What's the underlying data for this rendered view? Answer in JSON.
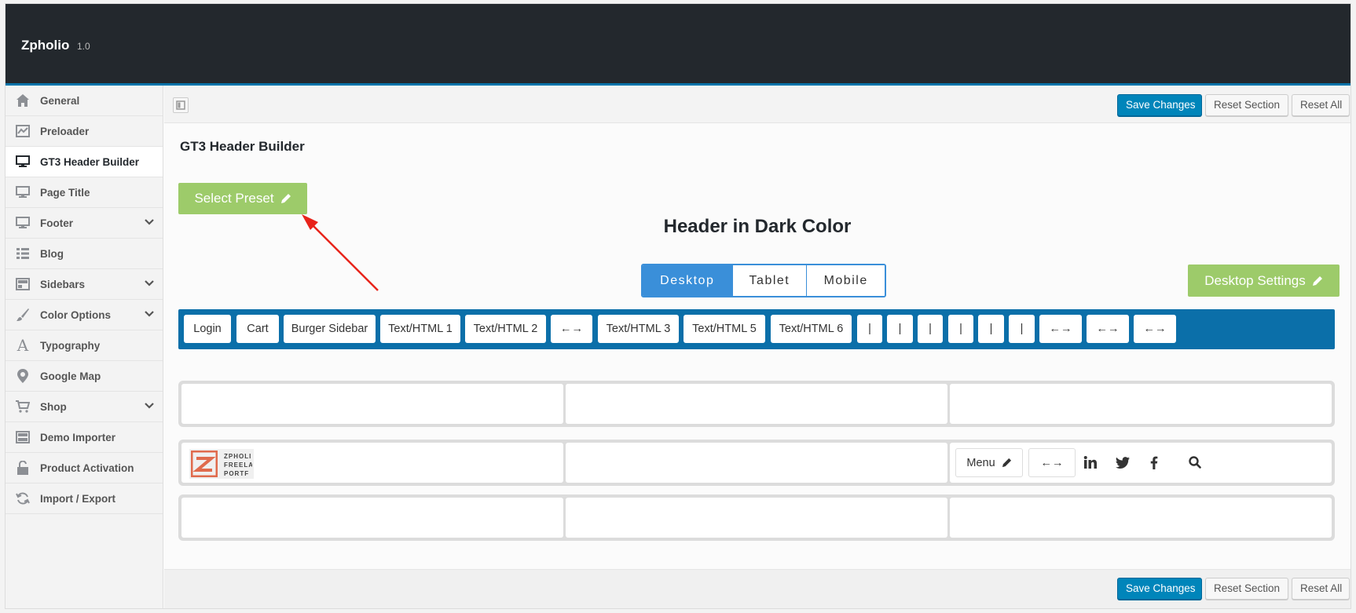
{
  "app": {
    "title": "Zpholio",
    "version": "1.0"
  },
  "sidebar": {
    "items": [
      {
        "label": "General",
        "icon": "home-icon"
      },
      {
        "label": "Preloader",
        "icon": "chart-icon"
      },
      {
        "label": "GT3 Header Builder",
        "icon": "monitor-icon",
        "active": true
      },
      {
        "label": "Page Title",
        "icon": "monitor-icon"
      },
      {
        "label": "Footer",
        "icon": "monitor-icon",
        "expandable": true
      },
      {
        "label": "Blog",
        "icon": "list-icon"
      },
      {
        "label": "Sidebars",
        "icon": "layout-icon",
        "expandable": true
      },
      {
        "label": "Color Options",
        "icon": "brush-icon",
        "expandable": true
      },
      {
        "label": "Typography",
        "icon": "font-icon"
      },
      {
        "label": "Google Map",
        "icon": "map-pin-icon"
      },
      {
        "label": "Shop",
        "icon": "cart-icon",
        "expandable": true
      },
      {
        "label": "Demo Importer",
        "icon": "layout-icon"
      },
      {
        "label": "Product Activation",
        "icon": "unlock-icon"
      },
      {
        "label": "Import / Export",
        "icon": "refresh-icon"
      }
    ]
  },
  "toolbar": {
    "save_label": "Save Changes",
    "reset_section_label": "Reset Section",
    "reset_all_label": "Reset All"
  },
  "builder": {
    "section_title": "GT3 Header Builder",
    "select_preset_label": "Select Preset",
    "preset_title": "Header in Dark Color",
    "device_tabs": [
      "Desktop",
      "Tablet",
      "Mobile"
    ],
    "active_device": "Desktop",
    "device_settings_label": "Desktop Settings",
    "elements": [
      "Login",
      "Cart",
      "Burger Sidebar",
      "Text/HTML 1",
      "Text/HTML 2",
      "←→",
      "Text/HTML 3",
      "Text/HTML 5",
      "Text/HTML 6",
      "|",
      "|",
      "|",
      "|",
      "|",
      "|",
      "←→",
      "←→",
      "←→"
    ],
    "middle_row_right": {
      "menu_label": "Menu",
      "spacer_label": "←→",
      "icons": [
        "linkedin-icon",
        "twitter-icon",
        "facebook-icon",
        "search-icon"
      ]
    },
    "logo_text": [
      "ZPHOLI",
      "FREELA",
      "PORTF"
    ]
  },
  "colors": {
    "accent": "#0085ba",
    "green": "#9dcb6a",
    "header_bar": "#0b6fa9",
    "topbar": "#23282d",
    "arrow": "#e8231a"
  }
}
